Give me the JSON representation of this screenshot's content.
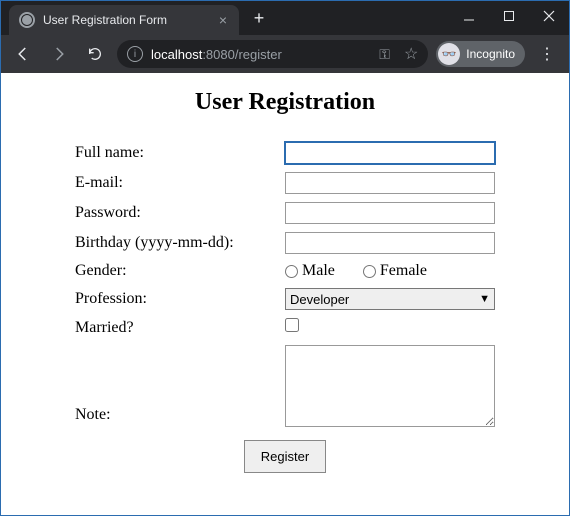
{
  "browser": {
    "tab_title": "User Registration Form",
    "url_host": "localhost",
    "url_port": ":8080",
    "url_path": "/register",
    "incognito_label": "Incognito"
  },
  "page": {
    "heading": "User Registration"
  },
  "form": {
    "fullname_label": "Full name:",
    "fullname_value": "",
    "email_label": "E-mail:",
    "email_value": "",
    "password_label": "Password:",
    "password_value": "",
    "birthday_label": "Birthday (yyyy-mm-dd):",
    "birthday_value": "",
    "gender_label": "Gender:",
    "gender_options": {
      "male": "Male",
      "female": "Female"
    },
    "profession_label": "Profession:",
    "profession_selected": "Developer",
    "married_label": "Married?",
    "married_checked": false,
    "note_label": "Note:",
    "note_value": "",
    "submit_label": "Register"
  }
}
